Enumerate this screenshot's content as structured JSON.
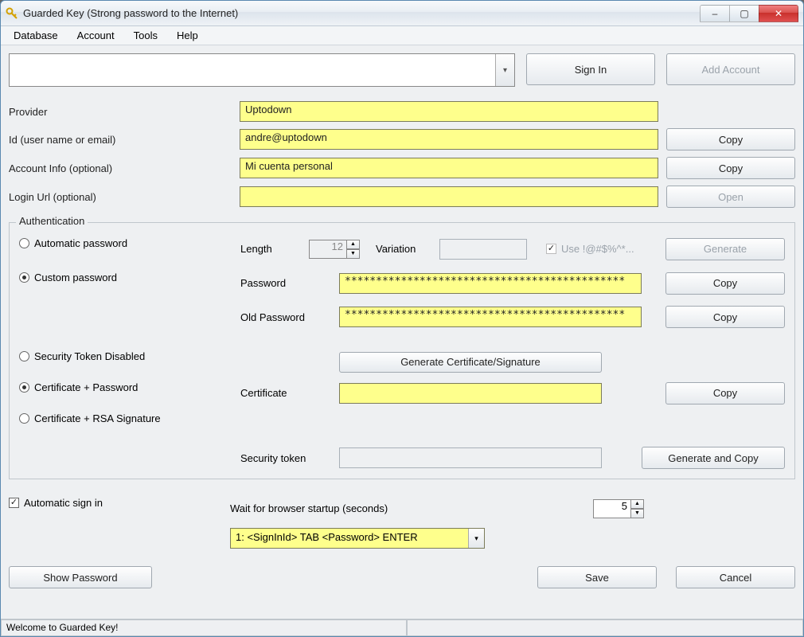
{
  "window": {
    "title": "Guarded Key (Strong password to the Internet)",
    "icon": "key-icon"
  },
  "window_controls": {
    "minimize": "–",
    "maximize": "▢",
    "close": "✕"
  },
  "menu": {
    "database": "Database",
    "account": "Account",
    "tools": "Tools",
    "help": "Help"
  },
  "top": {
    "search_value": "",
    "sign_in": "Sign In",
    "add_account": "Add Account"
  },
  "fields": {
    "provider_label": "Provider",
    "provider_value": "Uptodown",
    "id_label": "Id (user name or email)",
    "id_value": "andre@uptodown",
    "account_info_label": "Account Info (optional)",
    "account_info_value": "Mi cuenta personal",
    "login_url_label": "Login Url (optional)",
    "login_url_value": ""
  },
  "buttons": {
    "copy": "Copy",
    "open": "Open",
    "generate": "Generate",
    "generate_cert": "Generate Certificate/Signature",
    "generate_copy": "Generate and Copy",
    "show_password": "Show Password",
    "save": "Save",
    "cancel": "Cancel"
  },
  "auth": {
    "legend": "Authentication",
    "automatic_password": "Automatic password",
    "custom_password": "Custom password",
    "length_label": "Length",
    "length_value": "12",
    "variation_label": "Variation",
    "variation_value": "",
    "use_symbols_label": "Use !@#$%^*...",
    "password_label": "Password",
    "password_value": "*********************************************",
    "old_password_label": "Old Password",
    "old_password_value": "*********************************************",
    "sec_token_disabled": "Security Token Disabled",
    "cert_password": "Certificate + Password",
    "cert_rsa": "Certificate + RSA Signature",
    "certificate_label": "Certificate",
    "certificate_value": "",
    "security_token_label": "Security token",
    "security_token_value": ""
  },
  "signin": {
    "auto_label": "Automatic sign in",
    "wait_label": "Wait for browser startup (seconds)",
    "wait_value": "5",
    "sequence": "1: <SignInId> TAB <Password> ENTER"
  },
  "status": {
    "text": "Welcome to Guarded Key!"
  }
}
